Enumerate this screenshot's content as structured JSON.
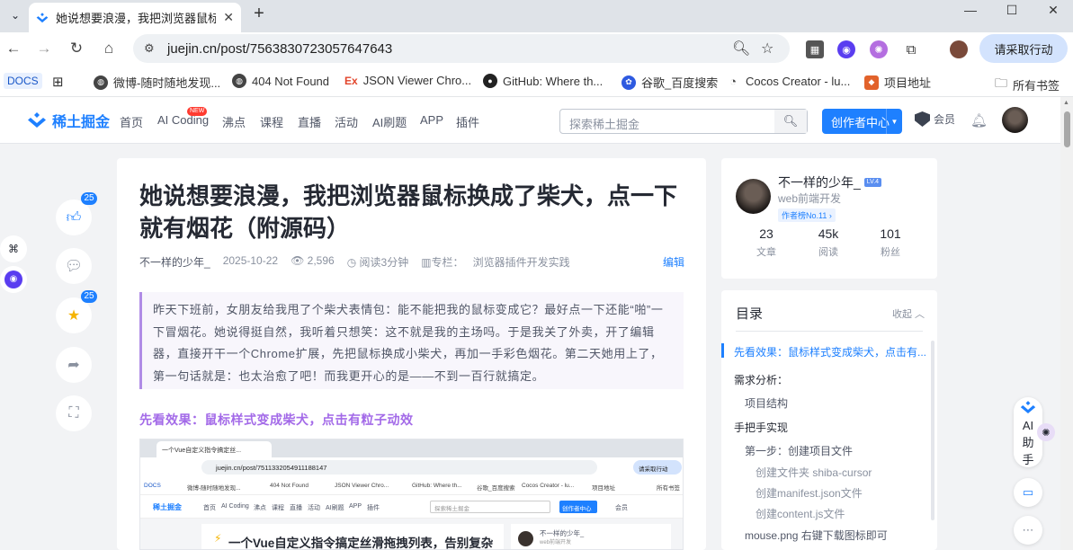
{
  "browser": {
    "tab_title": "她说想要浪漫，我把浏览器鼠标换成了柴犬",
    "url": "juejin.cn/post/7563830723057647643",
    "profile_button": "请采取行动",
    "bookmarks": [
      {
        "label": "DOCS"
      },
      {
        "label": "微博-随时随地发现..."
      },
      {
        "label": "404 Not Found"
      },
      {
        "label": "JSON Viewer Chro..."
      },
      {
        "label": "GitHub: Where th..."
      },
      {
        "label": "谷歌_百度搜索"
      },
      {
        "label": "Cocos Creator - lu..."
      },
      {
        "label": "项目地址"
      }
    ],
    "all_bookmarks": "所有书签"
  },
  "site": {
    "logo_text": "稀土掘金",
    "nav": [
      "首页",
      "AI Coding",
      "沸点",
      "课程",
      "直播",
      "活动",
      "AI刷题",
      "APP",
      "插件"
    ],
    "new_badge": "NEW",
    "search_placeholder": "探索稀土掘金",
    "creator_button": "创作者中心",
    "vip_label": "会员"
  },
  "floating_actions": {
    "like_count": "25",
    "collect_count": "25"
  },
  "article": {
    "title": "她说想要浪漫，我把浏览器鼠标换成了柴犬，点一下就有烟花（附源码）",
    "author": "不一样的少年_",
    "date": "2025-10-22",
    "views": "2,596",
    "read_time": "阅读3分钟",
    "column_prefix": "专栏：",
    "column": "浏览器插件开发实践",
    "edit": "编辑",
    "quote": "昨天下班前，女朋友给我甩了个柴犬表情包：能不能把我的鼠标变成它？最好点一下还能“啪”一下冒烟花。她说得挺自然，我听着只想笑：这不就是我的主场吗。于是我关了外卖，开了编辑器，直接开干一个Chrome扩展，先把鼠标换成小柴犬，再加一手彩色烟花。第二天她用上了，第一句话就是：也太治愈了吧！而我更开心的是——不到一百行就搞定。",
    "section_heading": "先看效果：鼠标样式变成柴犬，点击有粒子动效"
  },
  "embedded_screenshot": {
    "tab": "一个Vue自定义指令搞定丝...",
    "url": "juejin.cn/post/7511332054911188147",
    "profile": "请采取行动",
    "bookmarks": [
      "DOCS",
      "微博-随时随地发现...",
      "404 Not Found",
      "JSON Viewer Chro...",
      "GitHub: Where th...",
      "谷歌_百度搜索",
      "Cocos Creator - lu...",
      "项目地址",
      "所有书签"
    ],
    "logo": "稀土掘金",
    "nav": [
      "首页",
      "AI Coding",
      "沸点",
      "课程",
      "直播",
      "活动",
      "AI刷题",
      "APP",
      "插件"
    ],
    "search": "探索稀土掘金",
    "creator": "创作者中心",
    "vip": "会员",
    "card_title": "一个Vue自定义指令搞定丝滑拖拽列表，告别复杂",
    "side_author": "不一样的少年_",
    "side_title": "web前端开发"
  },
  "author_card": {
    "name": "不一样的少年_",
    "level": "LV.4",
    "title": "web前端开发",
    "rank": "作者榜No.11",
    "stats": [
      {
        "value": "23",
        "label": "文章"
      },
      {
        "value": "45k",
        "label": "阅读"
      },
      {
        "value": "101",
        "label": "粉丝"
      }
    ]
  },
  "toc": {
    "title": "目录",
    "collapse": "收起",
    "items": [
      {
        "label": "先看效果：鼠标样式变成柴犬，点击有..."
      },
      {
        "label": "需求分析："
      },
      {
        "label": "项目结构"
      },
      {
        "label": "手把手实现"
      },
      {
        "label": "第一步：创建项目文件"
      },
      {
        "label": "创建文件夹 shiba-cursor"
      },
      {
        "label": "创建manifest.json文件"
      },
      {
        "label": "创建content.js文件"
      },
      {
        "label": "mouse.png 右键下载图标即可"
      }
    ]
  },
  "ai_assistant": {
    "label": "AI助手"
  },
  "colors": {
    "brand": "#1e80ff",
    "quote_accent": "#b08ce6",
    "heading_accent": "#a36ae8"
  }
}
